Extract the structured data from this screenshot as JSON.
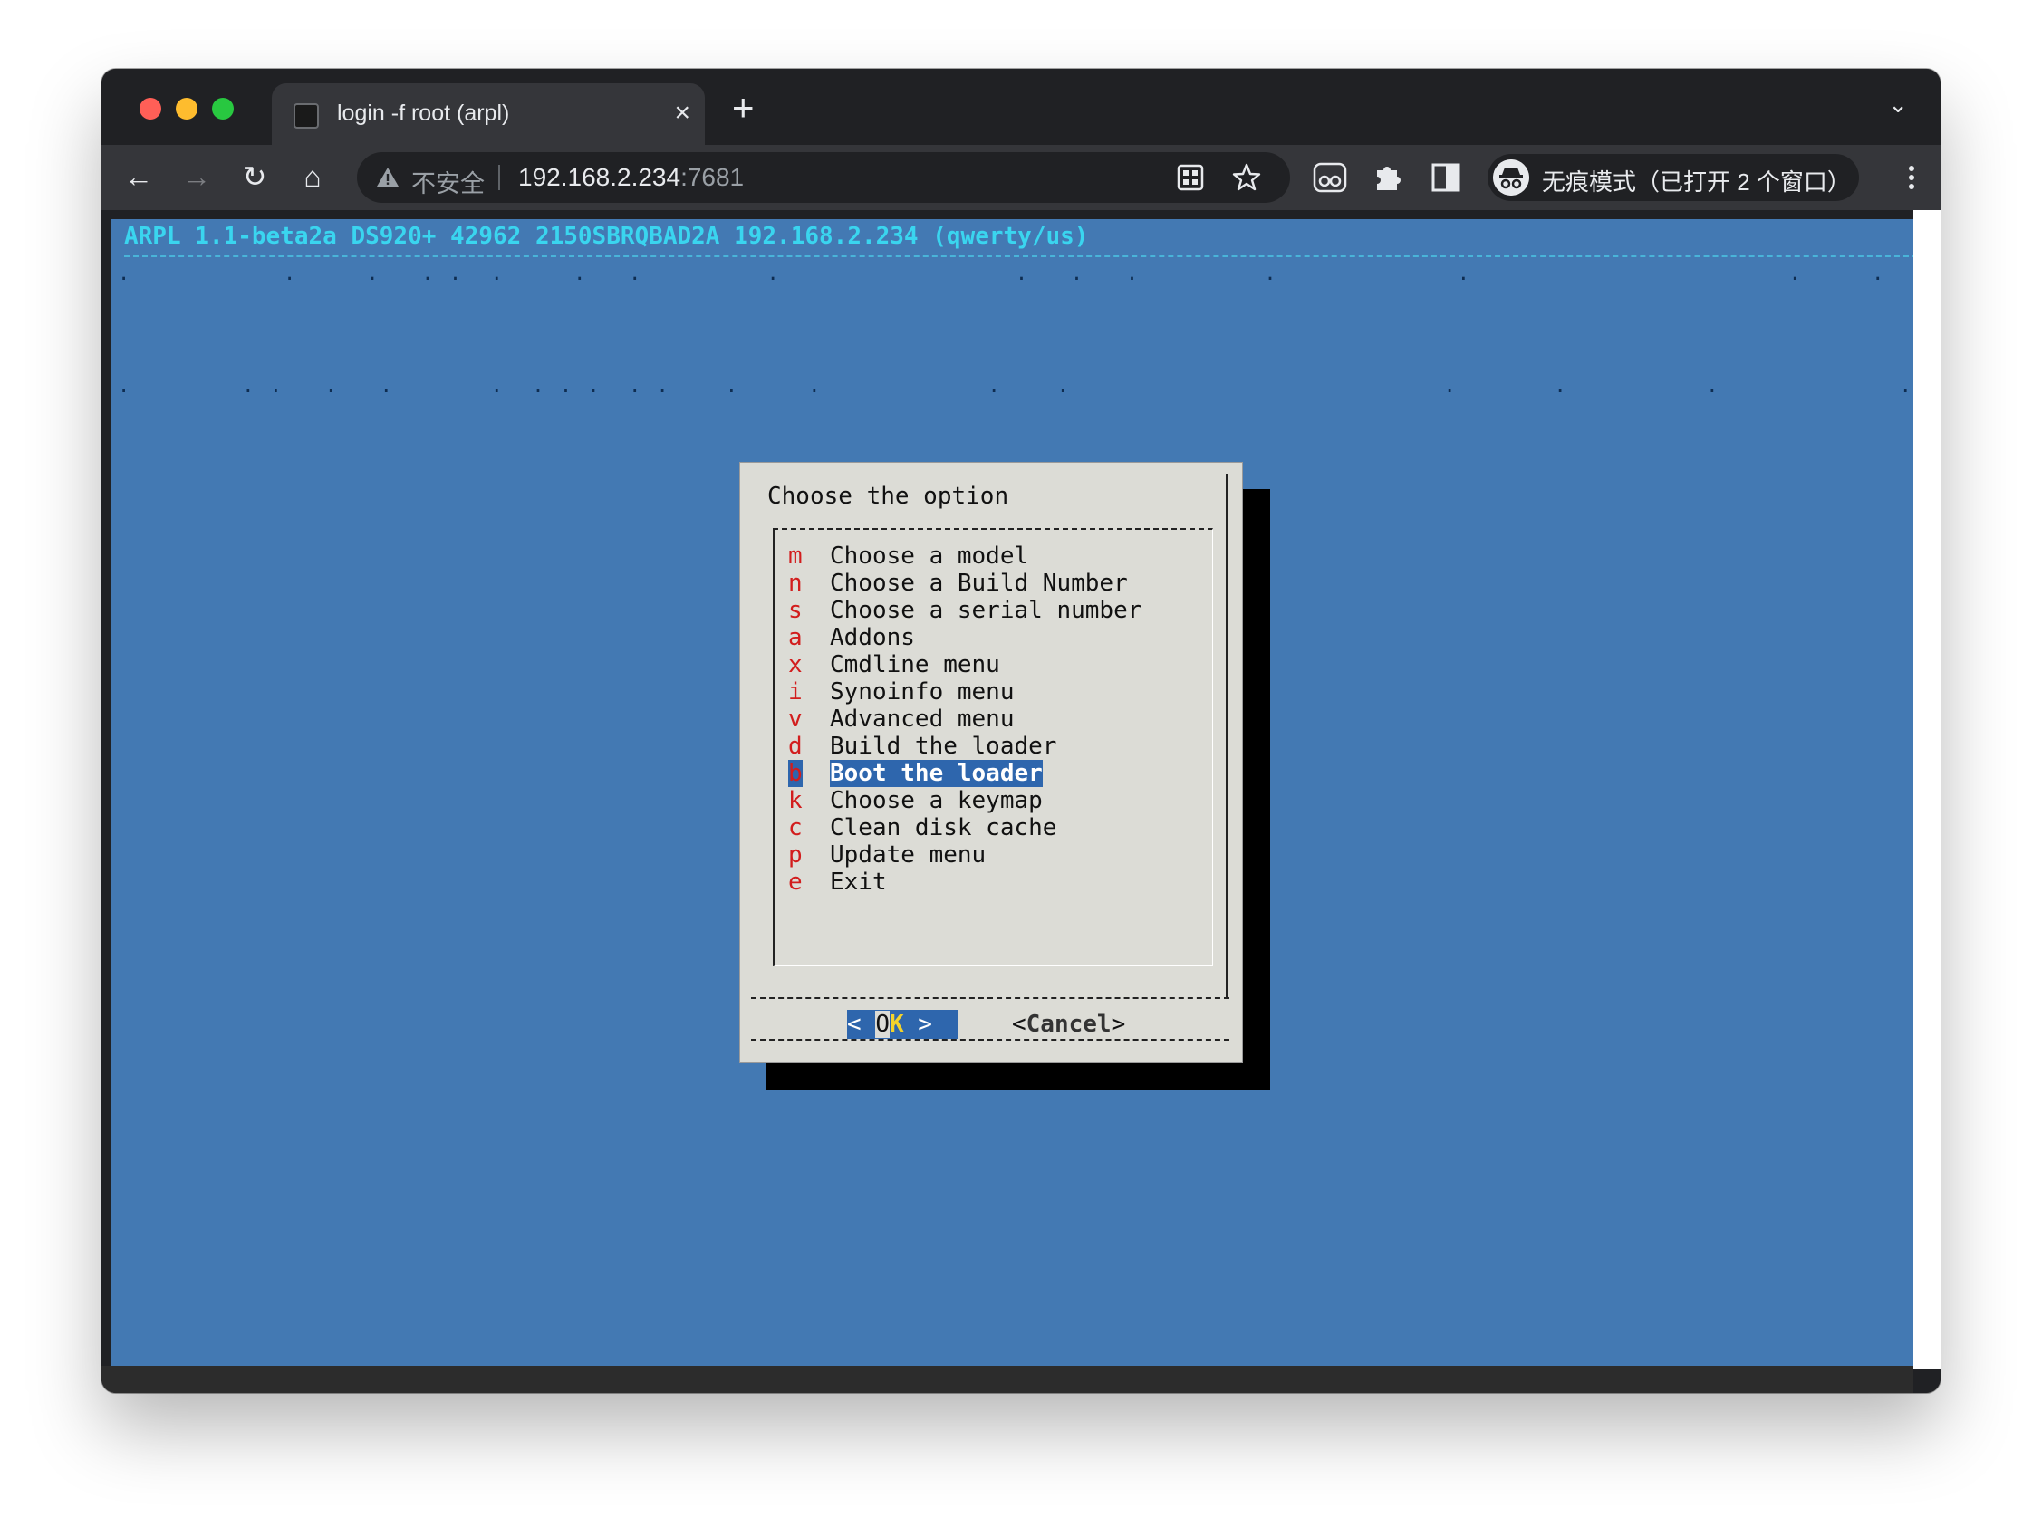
{
  "browser": {
    "tab": {
      "title": "login -f root (arpl)",
      "close_glyph": "×"
    },
    "new_tab_glyph": "+",
    "tab_menu_glyph": "⌄",
    "nav": {
      "back": "←",
      "forward": "→",
      "reload": "↻",
      "home": "⌂"
    },
    "address": {
      "security_label": "不安全",
      "host": "192.168.2.234",
      "port": ":7681"
    },
    "toolbar_icons": [
      "translate-icon",
      "bookmark-star-icon",
      "eyes-extension-icon",
      "extensions-puzzle-icon",
      "side-panel-icon",
      "more-menu-icon"
    ],
    "incognito_label": "无痕模式（已打开 2 个窗口）"
  },
  "terminal": {
    "backtitle": "ARPL 1.1-beta2a DS920+ 42962 2150SBRQBAD2A 192.168.2.234 (qwerty/us)",
    "dialog": {
      "title": "Choose the option",
      "items": [
        {
          "key": "m",
          "label": "Choose a model"
        },
        {
          "key": "n",
          "label": "Choose a Build Number"
        },
        {
          "key": "s",
          "label": "Choose a serial number"
        },
        {
          "key": "a",
          "label": "Addons"
        },
        {
          "key": "x",
          "label": "Cmdline menu"
        },
        {
          "key": "i",
          "label": "Synoinfo menu"
        },
        {
          "key": "v",
          "label": "Advanced menu"
        },
        {
          "key": "d",
          "label": "Build the loader"
        },
        {
          "key": "b",
          "label": "Boot the loader"
        },
        {
          "key": "k",
          "label": "Choose a keymap"
        },
        {
          "key": "c",
          "label": "Clean disk cache"
        },
        {
          "key": "p",
          "label": "Update menu"
        },
        {
          "key": "e",
          "label": "Exit"
        }
      ],
      "selected_key": "b",
      "ok": {
        "left": "< ",
        "o": "O",
        "k": "K",
        "right": " >"
      },
      "cancel": {
        "open": "<",
        "word": "Cancel",
        "close": ">"
      }
    }
  },
  "colors": {
    "terminal_bg": "#4379b3",
    "backtitle": "#3ad5ef",
    "hotkey": "#d21d1d",
    "highlight": "#2e66ad",
    "dialog_bg": "#dcdcd6"
  }
}
